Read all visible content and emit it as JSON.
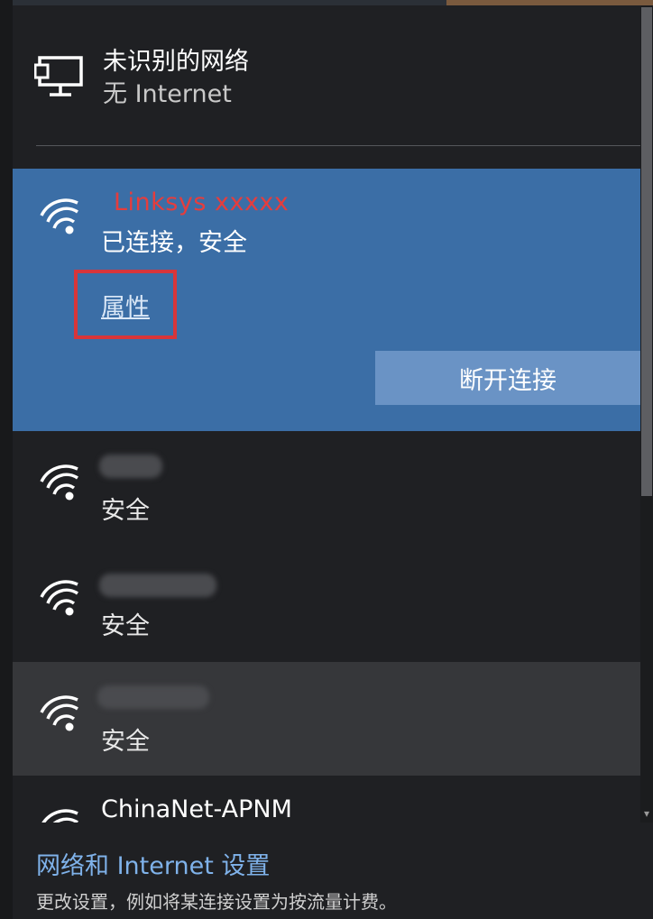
{
  "header_network": {
    "name": "未识别的网络",
    "status": "无 Internet"
  },
  "connected_network": {
    "name": "Linksys xxxxx",
    "status": "已连接，安全",
    "properties_label": "属性",
    "disconnect_label": "断开连接",
    "name_color": "#e53d3d",
    "highlight_box_color": "#d8353a"
  },
  "networks": [
    {
      "status": "安全",
      "name_obscured": true
    },
    {
      "status": "安全",
      "name_obscured": true
    },
    {
      "status": "安全",
      "name_obscured": true
    },
    {
      "name": "ChinaNet-APNM"
    }
  ],
  "footer": {
    "settings_link": "网络和 Internet 设置",
    "settings_desc": "更改设置，例如将某连接设置为按流量计费。"
  },
  "icons": {
    "header": "desktop-network-icon",
    "wifi": "wifi-signal-icon",
    "scroll": "chevron-down-icon"
  },
  "colors": {
    "panel_bg": "#1f2023",
    "selected_bg": "#3b6ea6",
    "button_bg": "#6a93c5",
    "link": "#7fb2ea"
  }
}
